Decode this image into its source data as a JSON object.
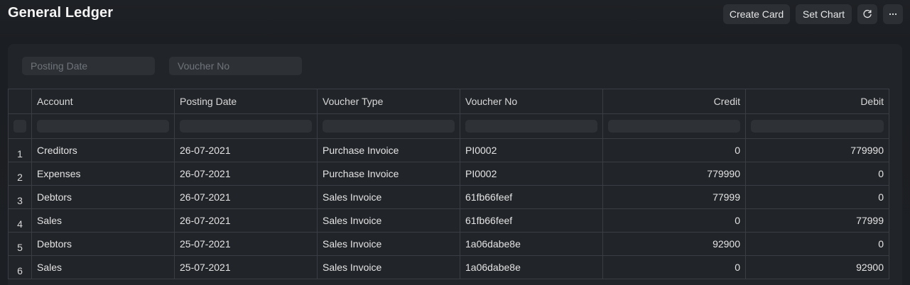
{
  "header": {
    "title": "General Ledger",
    "create_card_label": "Create Card",
    "set_chart_label": "Set Chart",
    "refresh_icon": "refresh-icon",
    "more_icon": "more-horizontal-icon"
  },
  "filters": {
    "posting_date_placeholder": "Posting Date",
    "voucher_no_placeholder": "Voucher No"
  },
  "table": {
    "columns": [
      "Account",
      "Posting Date",
      "Voucher Type",
      "Voucher No",
      "Credit",
      "Debit"
    ],
    "rows": [
      {
        "index": "1",
        "account": "Creditors",
        "posting_date": "26-07-2021",
        "voucher_type": "Purchase Invoice",
        "voucher_no": "PI0002",
        "credit": "0",
        "debit": "779990"
      },
      {
        "index": "2",
        "account": "Expenses",
        "posting_date": "26-07-2021",
        "voucher_type": "Purchase Invoice",
        "voucher_no": "PI0002",
        "credit": "779990",
        "debit": "0"
      },
      {
        "index": "3",
        "account": "Debtors",
        "posting_date": "26-07-2021",
        "voucher_type": "Sales Invoice",
        "voucher_no": "61fb66feef",
        "credit": "77999",
        "debit": "0"
      },
      {
        "index": "4",
        "account": "Sales",
        "posting_date": "26-07-2021",
        "voucher_type": "Sales Invoice",
        "voucher_no": "61fb66feef",
        "credit": "0",
        "debit": "77999"
      },
      {
        "index": "5",
        "account": "Debtors",
        "posting_date": "25-07-2021",
        "voucher_type": "Sales Invoice",
        "voucher_no": "1a06dabe8e",
        "credit": "92900",
        "debit": "0"
      },
      {
        "index": "6",
        "account": "Sales",
        "posting_date": "25-07-2021",
        "voucher_type": "Sales Invoice",
        "voucher_no": "1a06dabe8e",
        "credit": "0",
        "debit": "92900"
      }
    ]
  },
  "colors": {
    "background": "#1a1d21",
    "panel": "#212428",
    "button": "#2c3035",
    "border": "#3a3e44"
  }
}
